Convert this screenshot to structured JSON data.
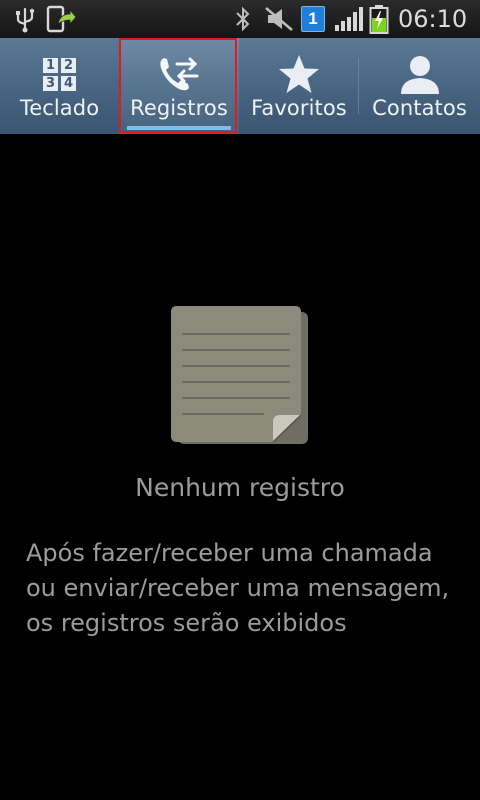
{
  "status_bar": {
    "time": "06:10",
    "notification_badge": "1",
    "left_icons": [
      "usb-icon",
      "screenshot-share-icon"
    ],
    "right_icons": [
      "bluetooth-icon",
      "mute-icon",
      "notification-badge-icon",
      "signal-icon",
      "battery-charging-icon"
    ]
  },
  "tabs": [
    {
      "label": "Teclado",
      "icon": "keypad-icon"
    },
    {
      "label": "Registros",
      "icon": "call-log-icon",
      "active": true
    },
    {
      "label": "Favoritos",
      "icon": "star-icon"
    },
    {
      "label": "Contatos",
      "icon": "contact-person-icon"
    }
  ],
  "keypad_digits": [
    "1",
    "2",
    "3",
    "4"
  ],
  "empty_state": {
    "icon": "document-icon",
    "title": "Nenhum registro",
    "description": "Após fazer/receber uma chamada ou enviar/receber uma mensagem, os registros serão exibidos"
  },
  "colors": {
    "tab_bar": "#4a6784",
    "active_underline": "#7fbde8",
    "focus_outline": "#e01b1b",
    "empty_text": "#9c9c9c",
    "badge": "#1f7fd6",
    "charging": "#7ed321"
  }
}
